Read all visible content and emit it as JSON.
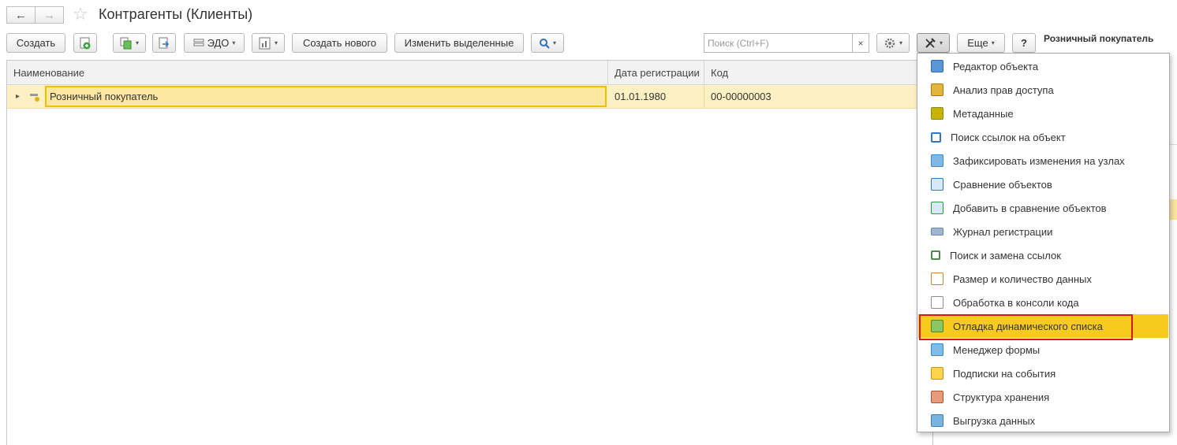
{
  "window": {
    "title": "Контрагенты (Клиенты)",
    "back_glyph": "←",
    "forward_glyph": "→",
    "favorite_glyph": "☆"
  },
  "toolbar": {
    "create_label": "Создать",
    "edo_label": "ЭДО",
    "create_new_label": "Создать нового",
    "edit_selected_label": "Изменить выделенные",
    "more_label": "Еще",
    "help_label": "?",
    "caret": "▾"
  },
  "search": {
    "placeholder": "Поиск (Ctrl+F)",
    "clear_glyph": "×"
  },
  "side_panel": {
    "label": "Розничный покупатель"
  },
  "table": {
    "columns": [
      "Наименование",
      "Дата регистрации",
      "Код"
    ],
    "rows": [
      {
        "name": "Розничный покупатель",
        "date": "01.01.1980",
        "code": "00-00000003"
      }
    ],
    "expand_glyph": "▸"
  },
  "menu": {
    "items": [
      {
        "label": "Редактор объекта",
        "icon": "editor-icon"
      },
      {
        "label": "Анализ прав доступа",
        "icon": "lock-icon"
      },
      {
        "label": "Метаданные",
        "icon": "metadata-icon"
      },
      {
        "label": "Поиск ссылок на объект",
        "icon": "search-links-icon"
      },
      {
        "label": "Зафиксировать изменения на узлах",
        "icon": "nodes-icon"
      },
      {
        "label": "Сравнение объектов",
        "icon": "compare-icon"
      },
      {
        "label": "Добавить в сравнение объектов",
        "icon": "add-compare-icon"
      },
      {
        "label": "Журнал регистрации",
        "icon": "journal-icon"
      },
      {
        "label": "Поиск и замена ссылок",
        "icon": "replace-links-icon"
      },
      {
        "label": "Размер и количество данных",
        "icon": "data-size-icon"
      },
      {
        "label": "Обработка в консоли кода",
        "icon": "code-console-icon"
      },
      {
        "label": "Отладка динамического списка",
        "icon": "debug-list-icon",
        "active": true
      },
      {
        "label": "Менеджер формы",
        "icon": "form-manager-icon"
      },
      {
        "label": "Подписки на события",
        "icon": "events-icon"
      },
      {
        "label": "Структура хранения",
        "icon": "storage-icon"
      },
      {
        "label": "Выгрузка данных",
        "icon": "export-icon"
      }
    ]
  },
  "colors": {
    "row_selected": "#fdf1c4",
    "menu_active": "#f7cb1e",
    "highlight_outline": "#e0141c"
  }
}
